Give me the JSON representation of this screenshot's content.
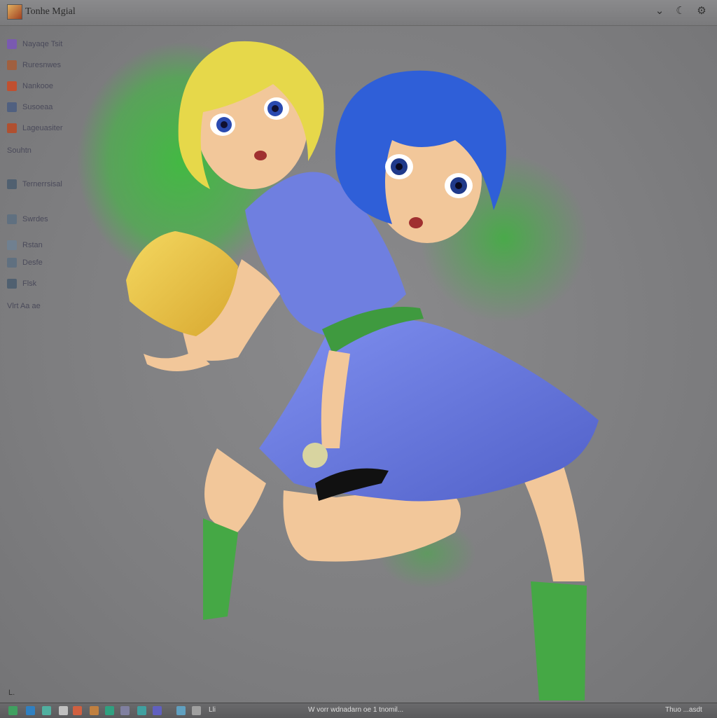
{
  "window": {
    "title": "Tonhe Mgial",
    "controls": {
      "minimize_icon": "chevron-down-icon",
      "moon_icon": "moon-icon",
      "settings_icon": "gear-icon"
    }
  },
  "sidebar": {
    "items": [
      {
        "label": "Nayaqe Tsit",
        "icon": "app-icon",
        "color": "#7a5ab0"
      },
      {
        "label": "Ruresnwes",
        "icon": "folder-icon",
        "color": "#a06040"
      },
      {
        "label": "Nankooe",
        "icon": "app-icon",
        "color": "#c05030"
      },
      {
        "label": "Susoeaa",
        "icon": "edit-icon",
        "color": "#506080"
      },
      {
        "label": "Lageuasiter",
        "icon": "app-icon",
        "color": "#b05030"
      },
      {
        "label": "Souhtn",
        "icon": "",
        "color": ""
      },
      {
        "label": "Ternerrsisal",
        "icon": "monitor-icon",
        "color": "#506070"
      },
      {
        "label": "Swrdes",
        "icon": "figure-icon",
        "color": "#607080"
      },
      {
        "label": "Rstan",
        "icon": "cloud-icon",
        "color": "#708090"
      },
      {
        "label": "Desfe",
        "icon": "globe-icon",
        "color": "#607080"
      },
      {
        "label": "Flsk",
        "icon": "figure-icon",
        "color": "#506070"
      },
      {
        "label": "Vlrt Aa ae",
        "icon": "",
        "color": ""
      }
    ]
  },
  "taskbar": {
    "start_label": "L.",
    "mid_label": "Lli",
    "status_text": "W  vorr wdnadarn oe 1 tnomil...",
    "clock": "Thuo ...asdt"
  },
  "colors": {
    "background": "#7d7d7f",
    "green_glow": "#3cbf3c",
    "hair_yellow": "#e6d84a",
    "hair_blue": "#2f5fd8",
    "dress_blue": "#6f7fe0",
    "sock_green": "#45a845",
    "skin": "#f2c79a"
  }
}
